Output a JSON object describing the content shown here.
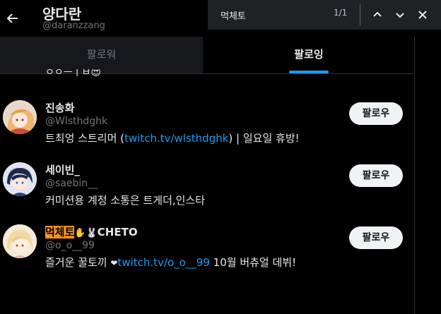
{
  "header": {
    "name": "양다란",
    "handle": "@daranzzang"
  },
  "tabs": [
    {
      "label": "팔로워"
    },
    {
      "label": "팔로잉"
    }
  ],
  "partial_text": "ㅇㅇㅡㅣㅂ😍",
  "users": [
    {
      "name": "진송화",
      "handle": "@Wlsthdghk",
      "bio_pre": "트최엉 스트리머 (",
      "bio_link": "twitch.tv/wlsthdghk",
      "bio_post": ") | 일요일 휴방!",
      "button": "팔로우"
    },
    {
      "name": "세이빈_",
      "handle": "@saebin__",
      "bio": "커미션용 계정 소통은 트게더,인스타",
      "button": "팔로우"
    },
    {
      "name_highlight": "먹체토",
      "name_rest": "CHETO",
      "emoji": "✋🐰",
      "handle": "@o_o__99",
      "bio_pre": "즐거운 꿀토끼 ",
      "bio_heart": "❤",
      "bio_link": "twitch.tv/o_o__99",
      "bio_post": " 10월 버츄얼 데뷔!",
      "button": "팔로우"
    }
  ],
  "find": {
    "query": "먹체토",
    "count": "1/1"
  },
  "colors": {
    "accent": "#1d9bf0",
    "highlight": "#f7931e",
    "background": "#000000"
  }
}
